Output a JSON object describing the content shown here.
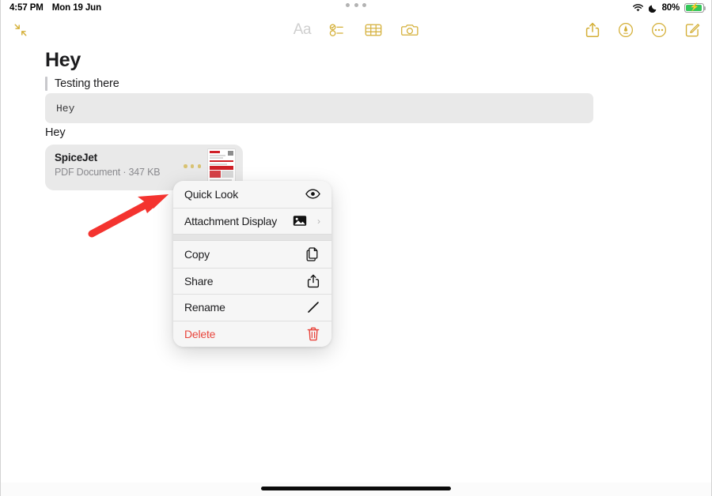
{
  "status_bar": {
    "time": "4:57 PM",
    "date": "Mon 19 Jun",
    "battery_percent": "80%",
    "wifi_icon": "wifi-icon",
    "dnd_icon": "moon-icon",
    "battery_icon": "battery-charging-icon",
    "multitask_icon": "multitasking-dots-icon",
    "accent_green": "#34c759"
  },
  "toolbar": {
    "collapse_icon": "collapse-arrows-icon",
    "format_label": "Aa",
    "checklist_icon": "checklist-icon",
    "table_icon": "table-icon",
    "camera_icon": "camera-icon",
    "share_icon": "share-icon",
    "markup_icon": "markup-pen-icon",
    "more_icon": "more-ellipsis-icon",
    "compose_icon": "compose-icon",
    "accent_color": "#d4af37",
    "disabled_color": "#cfcfcf"
  },
  "note": {
    "title": "Hey",
    "quote_text": "Testing there",
    "code_text": "Hey",
    "body_text": "Hey",
    "attachment": {
      "name": "SpiceJet",
      "meta": "PDF Document · 347 KB",
      "more_icon": "attachment-more-dots-icon",
      "thumbnail_icon": "pdf-thumbnail-preview"
    }
  },
  "context_menu": {
    "items": [
      {
        "label": "Quick Look",
        "icon": "eye-icon",
        "destructive": false,
        "submenu": false
      },
      {
        "label": "Attachment Display",
        "icon": "photo-icon",
        "destructive": false,
        "submenu": true
      },
      {
        "label": "Copy",
        "icon": "copy-icon",
        "destructive": false,
        "submenu": false
      },
      {
        "label": "Share",
        "icon": "share-icon",
        "destructive": false,
        "submenu": false
      },
      {
        "label": "Rename",
        "icon": "pencil-icon",
        "destructive": false,
        "submenu": false
      },
      {
        "label": "Delete",
        "icon": "trash-icon",
        "destructive": true,
        "submenu": false
      }
    ],
    "chevron_glyph": "›",
    "destructive_color": "#e8453c"
  },
  "annotation": {
    "arrow_icon": "red-arrow-pointer",
    "arrow_color": "#f4332f",
    "points_to": "Quick Look"
  },
  "home_indicator": {
    "icon": "home-indicator-bar"
  }
}
